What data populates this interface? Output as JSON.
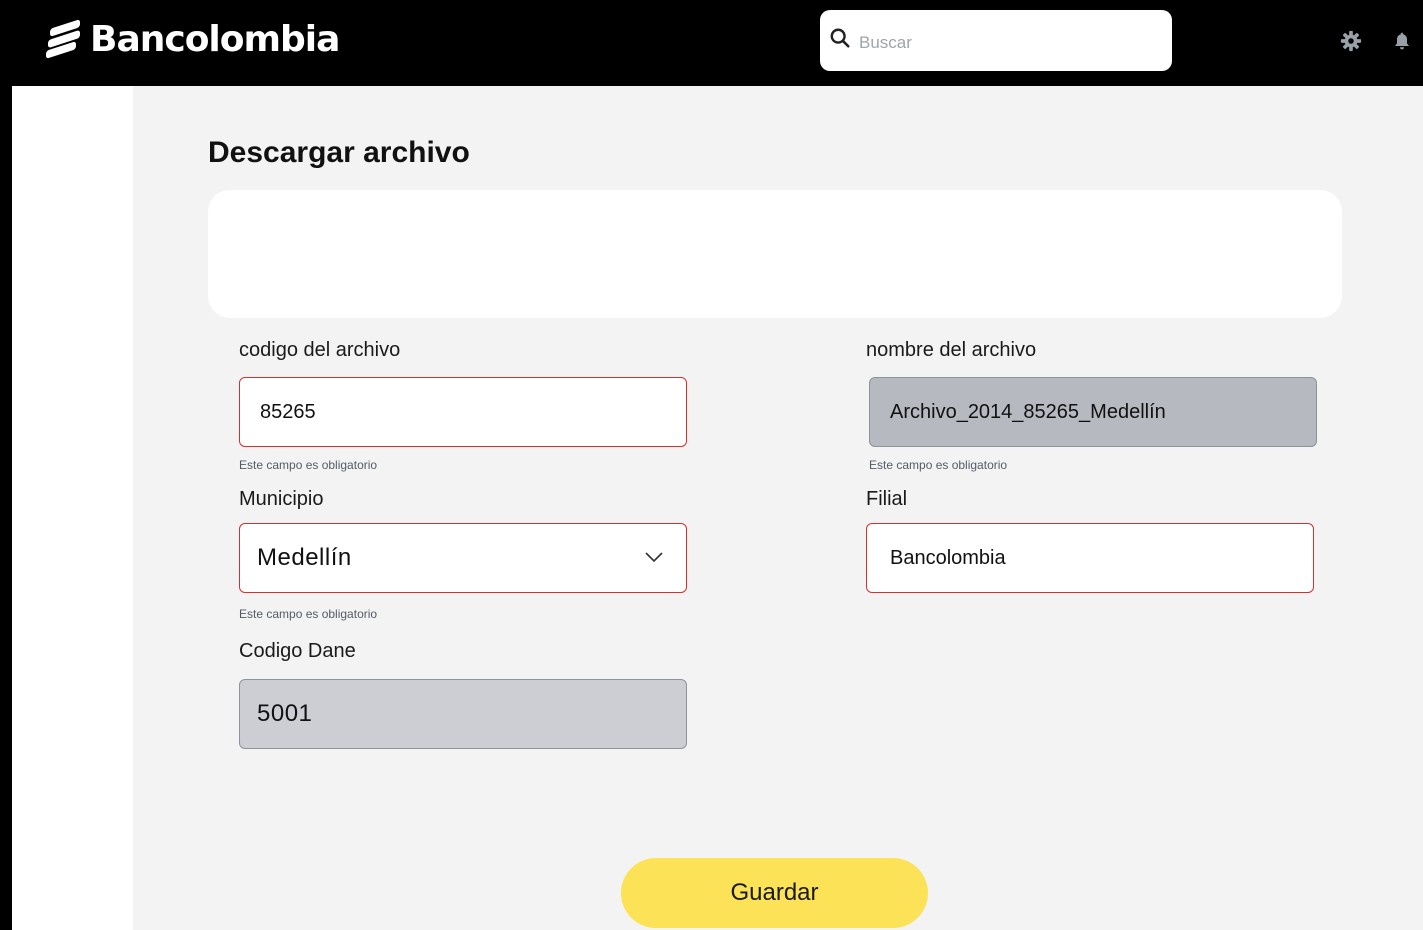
{
  "brand": {
    "name": "Bancolombia"
  },
  "search": {
    "placeholder": "Buscar"
  },
  "icons": {
    "search": "search-icon",
    "settings": "gear-icon",
    "notifications": "bell-icon",
    "select": "chevron-down-icon"
  },
  "page": {
    "title": "Descargar archivo"
  },
  "form": {
    "codigo": {
      "label": "codigo del archivo",
      "value": "85265",
      "hint": "Este campo es obligatorio"
    },
    "nombre": {
      "label": "nombre del archivo",
      "value": "Archivo_2014_85265_Medellín",
      "hint": "Este campo es obligatorio"
    },
    "municipio": {
      "label": "Municipio",
      "value": "Medellín",
      "hint": "Este campo es obligatorio"
    },
    "filial": {
      "label": "Filial",
      "value": "Bancolombia"
    },
    "dane": {
      "label": "Codigo Dane",
      "value": "5001"
    }
  },
  "actions": {
    "save_label": "Guardar"
  },
  "colors": {
    "accent": "#fbe256",
    "error_border": "#d62f2f",
    "topbar": "#000000",
    "background": "#f3f3f3"
  }
}
